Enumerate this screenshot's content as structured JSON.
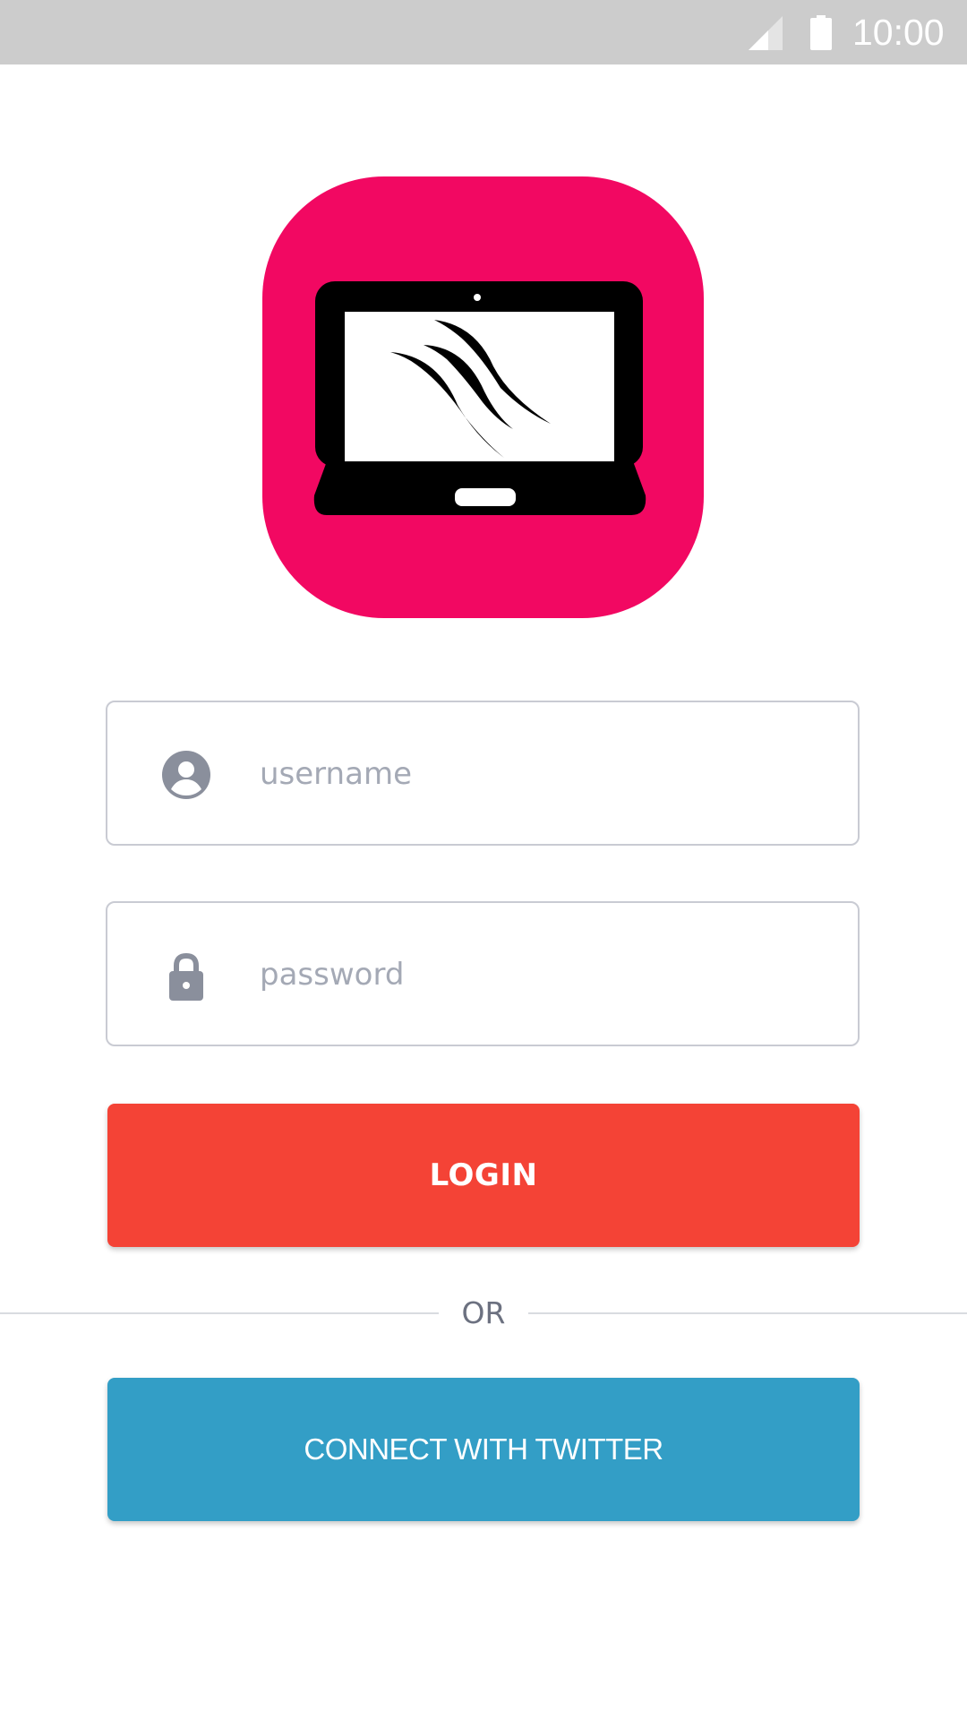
{
  "status_bar": {
    "time": "10:00",
    "signal_icon": "cellular-signal-icon",
    "battery_icon": "battery-icon",
    "background_color": "#cccccc"
  },
  "logo": {
    "icon": "laptop-claw-logo",
    "background_color": "#f20862"
  },
  "form": {
    "username": {
      "placeholder": "username",
      "value": "",
      "icon": "account-circle-icon"
    },
    "password": {
      "placeholder": "password",
      "value": "",
      "icon": "lock-icon"
    }
  },
  "login_button": {
    "label": "LOGIN",
    "color": "#f44336"
  },
  "divider": {
    "label": "OR"
  },
  "twitter_button": {
    "label": "CONNECT WITH TWITTER",
    "color": "#339ec6"
  }
}
